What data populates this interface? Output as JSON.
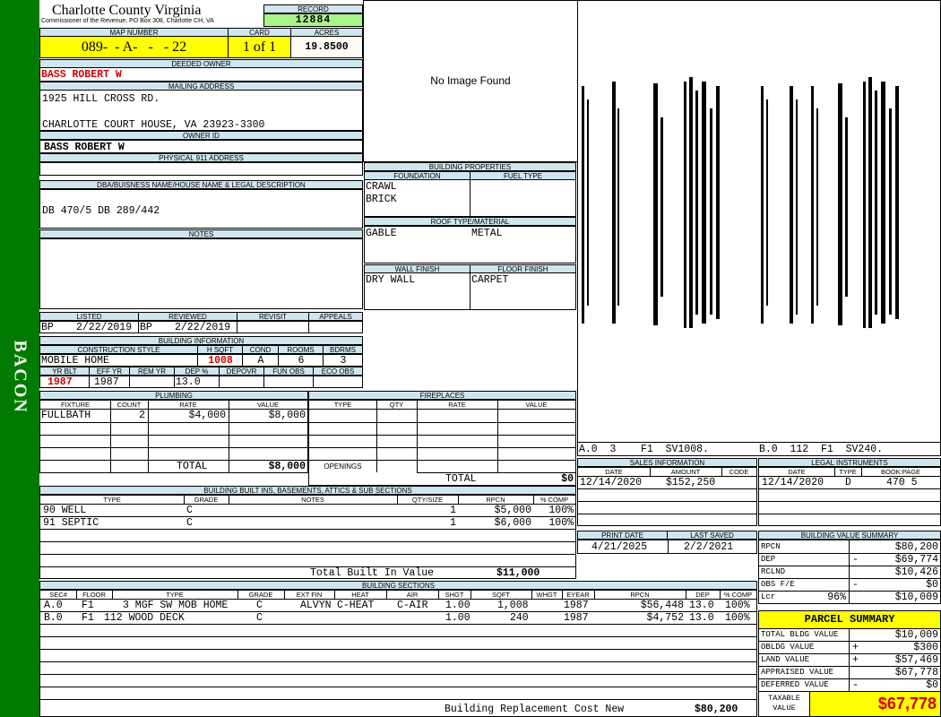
{
  "sidebar": {
    "label": "BACON"
  },
  "header": {
    "county": "Charlotte County Virginia",
    "commissioner": "Commissioner of the Revenue, PO Box 308, Charlotte CH, VA",
    "record_label": "RECORD",
    "record": "12884"
  },
  "parcel": {
    "map_label": "MAP NUMBER",
    "map_number": "089-  - A-   -   - 22",
    "card_label": "CARD",
    "card": "1 of 1",
    "acres_label": "ACRES",
    "acres": "19.8500"
  },
  "owner": {
    "deeded_label": "DEEDED OWNER",
    "deeded_owner": "BASS ROBERT W",
    "mailing_label": "MAILING ADDRESS",
    "address_line1": "1925 HILL CROSS RD.",
    "address_line3": "CHARLOTTE COURT HOUSE, VA 23923-3300",
    "owner_id_label": "OWNER ID",
    "owner_id": "BASS ROBERT W",
    "physical_label": "PHYSICAL 911 ADDRESS",
    "physical": ""
  },
  "legal": {
    "label": "DBA/BUISNESS NAME/HOUSE NAME & LEGAL DESCRIPTION",
    "text": "DB 470/5 DB 289/442"
  },
  "notes": {
    "label": "NOTES",
    "text": ""
  },
  "image": {
    "placeholder": "No Image Found"
  },
  "building_properties": {
    "title": "BUILDING PROPERTIES",
    "foundation_label": "FOUNDATION",
    "fuel_label": "FUEL TYPE",
    "foundation1": "CRAWL",
    "foundation2": "BRICK",
    "fuel": "",
    "roof_label": "ROOF TYPE/MATERIAL",
    "roof_type": "GABLE",
    "roof_material": "METAL",
    "wall_label": "WALL FINISH",
    "floor_label": "FLOOR FINISH",
    "wall": "DRY WALL",
    "floor": "CARPET"
  },
  "listing": {
    "listed_label": "LISTED",
    "reviewed_label": "REVIEWED",
    "revisit_label": "REVISIT",
    "appeals_label": "APPEALS",
    "listed_by": "BP",
    "listed_date": "2/22/2019",
    "reviewed_by": "BP",
    "reviewed_date": "2/22/2019",
    "revisit": "",
    "appeals": ""
  },
  "building_info": {
    "title": "BUILDING INFORMATION",
    "style_label": "CONSTRUCTION STYLE",
    "hsqft_label": "H SQFT",
    "cond_label": "COND",
    "rooms_label": "ROOMS",
    "bdrms_label": "BDRMS",
    "style": "MOBILE HOME",
    "hsqft": "1008",
    "cond": "A",
    "rooms": "6",
    "bdrms": "3",
    "yrblt_label": "YR BLT",
    "effyr_label": "EFF YR",
    "remyr_label": "REM YR",
    "dep_label": "DEP %",
    "depovr_label": "DEPOVR",
    "funobs_label": "FUN OBS",
    "ecoobs_label": "ECO OBS",
    "yrblt": "1987",
    "effyr": "1987",
    "remyr": "",
    "dep": "13.0",
    "depovr": "",
    "funobs": "",
    "ecoobs": ""
  },
  "plumbing": {
    "title": "PLUMBING",
    "cols": [
      "FIXTURE",
      "COUNT",
      "RATE",
      "VALUE"
    ],
    "rows": [
      {
        "fixture": "FULLBATH",
        "count": "2",
        "rate": "$4,000",
        "value": "$8,000"
      }
    ],
    "total_label": "TOTAL",
    "total": "$8,000"
  },
  "fireplaces": {
    "title": "FIREPLACES",
    "cols": [
      "TYPE",
      "QTY",
      "RATE",
      "VALUE"
    ],
    "openings_label": "OPENINGS",
    "total_label": "TOTAL",
    "total": "$0"
  },
  "builtins": {
    "title": "BUILDING BUILT INS, BASEMENTS, ATTICS & SUB SECTIONS",
    "cols": [
      "TYPE",
      "GRADE",
      "NOTES",
      "QTY/SIZE",
      "RPCN",
      "% COMP"
    ],
    "rows": [
      {
        "type": "90 WELL",
        "grade": "C",
        "notes": "",
        "qty": "1",
        "rpcn": "$5,000",
        "comp": "100%"
      },
      {
        "type": "91 SEPTIC",
        "grade": "C",
        "notes": "",
        "qty": "1",
        "rpcn": "$6,000",
        "comp": "100%"
      }
    ],
    "total_label": "Total Built In Value",
    "total": "$11,000"
  },
  "sketch": {
    "label_a": "A.0  3    F1  SV1008.",
    "label_b": "B.0  112  F1  SV240."
  },
  "sales": {
    "title": "SALES INFORMATION",
    "cols": [
      "DATE",
      "AMOUNT",
      "CODE"
    ],
    "rows": [
      {
        "date": "12/14/2020",
        "amount": "$152,250",
        "code": ""
      }
    ]
  },
  "legal_instruments": {
    "title": "LEGAL INSTRUMENTS",
    "cols": [
      "DATE",
      "TYPE",
      "BOOK:PAGE"
    ],
    "rows": [
      {
        "date": "12/14/2020",
        "type": "D",
        "book": "470 5"
      }
    ]
  },
  "print": {
    "print_label": "PRINT DATE",
    "saved_label": "LAST SAVED",
    "print_date": "4/21/2025",
    "last_saved": "2/2/2021"
  },
  "value_summary": {
    "title": "BUILDING VALUE SUMMARY",
    "rows": [
      {
        "label": "RPCN",
        "sign": "",
        "value": "$80,200"
      },
      {
        "label": "DEP",
        "sign": "-",
        "value": "$69,774"
      },
      {
        "label": "RCLND",
        "sign": "",
        "value": "$10,426"
      },
      {
        "label": "OBS F/E",
        "sign": "-",
        "value": "$0"
      },
      {
        "label": "Lcr",
        "pct": "96%",
        "sign": "",
        "value": "$10,009"
      }
    ]
  },
  "building_sections": {
    "title": "BUILDING SECTIONS",
    "cols": [
      "SEC#",
      "FLOOR",
      "TYPE",
      "GRADE",
      "EXT FIN",
      "HEAT",
      "AIR",
      "SHGT",
      "SQFT",
      "WHGT",
      "EYEAR",
      "RPCN",
      "DEP",
      "% COMP"
    ],
    "rows": [
      {
        "sec": "A.0",
        "floor": "F1",
        "type": "3 MGF SW MOB HOME",
        "grade": "C",
        "extfin": "ALVYN",
        "heat": "C-HEAT",
        "air": "C-AIR",
        "shgt": "1.00",
        "sqft": "1,008",
        "whgt": "",
        "eyear": "1987",
        "rpcn": "$56,448",
        "dep": "13.0",
        "comp": "100%"
      },
      {
        "sec": "B.0",
        "floor": "F1",
        "type": "112 WOOD DECK",
        "grade": "C",
        "extfin": "",
        "heat": "",
        "air": "",
        "shgt": "1.00",
        "sqft": "240",
        "whgt": "",
        "eyear": "1987",
        "rpcn": "$4,752",
        "dep": "13.0",
        "comp": "100%"
      }
    ],
    "replacement_label": "Building Replacement Cost New",
    "replacement": "$80,200"
  },
  "parcel_summary": {
    "title": "PARCEL SUMMARY",
    "rows": [
      {
        "label": "TOTAL BLDG VALUE",
        "sign": "",
        "value": "$10,009"
      },
      {
        "label": "OBLDG VALUE",
        "sign": "+",
        "value": "$300"
      },
      {
        "label": "LAND VALUE",
        "sign": "+",
        "value": "$57,469"
      },
      {
        "label": "APPRAISED VALUE",
        "sign": "",
        "value": "$67,778"
      },
      {
        "label": "DEFERRED VALUE",
        "sign": "-",
        "value": "$0"
      }
    ],
    "taxable_label1": "TAXABLE",
    "taxable_label2": "VALUE",
    "taxable": "$67,778"
  },
  "colors": {
    "sidebar": "#007a00",
    "header_bg": "#cfe6ee",
    "highlight": "#ffff00",
    "record_bg": "#a9f58c",
    "value_red": "#d00000"
  }
}
